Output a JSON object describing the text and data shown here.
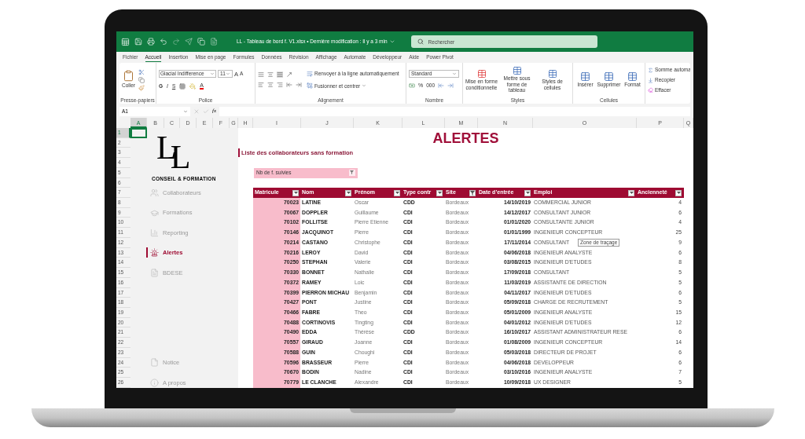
{
  "window": {
    "title": "LL - Tableau de bord f. V1.xlsx • Dernière modification : Il y a 3 min",
    "search": {
      "placeholder": "Rechercher"
    }
  },
  "menu": [
    {
      "label": "Fichier",
      "selected": false
    },
    {
      "label": "Accueil",
      "selected": true
    },
    {
      "label": "Insertion",
      "selected": false
    },
    {
      "label": "Mise en page",
      "selected": false
    },
    {
      "label": "Formules",
      "selected": false
    },
    {
      "label": "Données",
      "selected": false
    },
    {
      "label": "Révision",
      "selected": false
    },
    {
      "label": "Affichage",
      "selected": false
    },
    {
      "label": "Automate",
      "selected": false
    },
    {
      "label": "Développeur",
      "selected": false
    },
    {
      "label": "Aide",
      "selected": false
    },
    {
      "label": "Power Pivot",
      "selected": false
    }
  ],
  "ribbon": {
    "clipboard": {
      "paste": "Coller",
      "label": "Presse-papiers"
    },
    "font": {
      "name": "Glacial Indifference",
      "size": "11",
      "grow": "A",
      "shrink": "A",
      "bold": "G",
      "italic": "I",
      "underline": "S",
      "text_color_button": "A",
      "label": "Police"
    },
    "alignment": {
      "wrap": "Renvoyer à la ligne automatiquement",
      "merge": "Fusionner et centrer",
      "label": "Alignement"
    },
    "number": {
      "format": "Standard",
      "percent": "%",
      "thousands": "000",
      "label": "Nombre"
    },
    "styles": {
      "buttons": [
        "Mise en forme conditionnelle",
        "Mettre sous forme de tableau",
        "Styles de cellules"
      ],
      "label": "Styles"
    },
    "cells": {
      "buttons": [
        "Insérer",
        "Supprimer",
        "Format"
      ],
      "label": "Cellules"
    },
    "editing": {
      "buttons": [
        "Somme automa",
        "Recopier",
        "Effacer"
      ]
    }
  },
  "formula_bar": {
    "name_box": "A1",
    "fx": "fx"
  },
  "sheet": {
    "columns": [
      {
        "label": "A",
        "selected": true
      },
      {
        "label": "B",
        "selected": false
      },
      {
        "label": "C",
        "selected": false
      },
      {
        "label": "D",
        "selected": false
      },
      {
        "label": "E",
        "selected": false
      },
      {
        "label": "F",
        "selected": false
      },
      {
        "label": "G",
        "selected": false
      },
      {
        "label": "H",
        "selected": false
      },
      {
        "label": "I",
        "selected": false
      },
      {
        "label": "J",
        "selected": false
      },
      {
        "label": "K",
        "selected": false
      },
      {
        "label": "L",
        "selected": false
      },
      {
        "label": "M",
        "selected": false
      },
      {
        "label": "N",
        "selected": false
      },
      {
        "label": "O",
        "selected": false
      },
      {
        "label": "P",
        "selected": false
      },
      {
        "label": "Q",
        "selected": false
      }
    ],
    "rows": [
      {
        "label": "1",
        "selected": true
      },
      {
        "label": "2",
        "selected": false
      },
      {
        "label": "3",
        "selected": false
      },
      {
        "label": "4",
        "selected": false
      },
      {
        "label": "5",
        "selected": false
      },
      {
        "label": "6",
        "selected": false
      },
      {
        "label": "7",
        "selected": false
      },
      {
        "label": "8",
        "selected": false
      },
      {
        "label": "9",
        "selected": false
      },
      {
        "label": "10",
        "selected": false
      },
      {
        "label": "11",
        "selected": false
      },
      {
        "label": "12",
        "selected": false
      },
      {
        "label": "13",
        "selected": false
      },
      {
        "label": "14",
        "selected": false
      },
      {
        "label": "15",
        "selected": false
      },
      {
        "label": "16",
        "selected": false
      },
      {
        "label": "17",
        "selected": false
      },
      {
        "label": "18",
        "selected": false
      },
      {
        "label": "19",
        "selected": false
      },
      {
        "label": "20",
        "selected": false
      },
      {
        "label": "21",
        "selected": false
      },
      {
        "label": "22",
        "selected": false
      },
      {
        "label": "23",
        "selected": false
      },
      {
        "label": "24",
        "selected": false
      },
      {
        "label": "25",
        "selected": false
      },
      {
        "label": "26",
        "selected": false
      }
    ]
  },
  "sidebar": {
    "logo": {
      "letters": [
        "L",
        "L"
      ],
      "tagline": "CONSEIL & FORMATION"
    },
    "nav": [
      {
        "label": "Collaborateurs",
        "selected": false
      },
      {
        "label": "Formations",
        "selected": false
      },
      {
        "label": "Reporting",
        "selected": false
      },
      {
        "label": "Alertes",
        "selected": true
      },
      {
        "label": "BDESE",
        "selected": false
      },
      {
        "label": "Notice",
        "selected": false
      },
      {
        "label": "A propos",
        "selected": false
      }
    ]
  },
  "main": {
    "title": "ALERTES",
    "subtitle": "Liste des collaborateurs sans formation",
    "slicer": {
      "label": "Nb de f. suivies"
    },
    "tooltip": "Zone de traçage",
    "table": {
      "columns": [
        {
          "label": "Matricule",
          "filtered": false
        },
        {
          "label": "Nom",
          "filtered": false
        },
        {
          "label": "Prénom",
          "filtered": false
        },
        {
          "label": "Type contr",
          "filtered": false
        },
        {
          "label": "Site",
          "filtered": true
        },
        {
          "label": "Date d’entrée",
          "filtered": false
        },
        {
          "label": "Emploi",
          "filtered": false
        },
        {
          "label": "Ancienneté",
          "filtered": false
        }
      ],
      "rows": [
        [
          "70023",
          "LATINE",
          "Oscar",
          "CDD",
          "Bordeaux",
          "14/10/2019",
          "COMMERCIAL JUNIOR",
          "4"
        ],
        [
          "70067",
          "DOPPLER",
          "Guillaume",
          "CDI",
          "Bordeaux",
          "14/12/2017",
          "CONSULTANT JUNIOR",
          "6"
        ],
        [
          "70102",
          "FOLLITSE",
          "Pierre Etienne",
          "CDI",
          "Bordeaux",
          "01/01/2020",
          "CONSULTANTE JUNIOR",
          "4"
        ],
        [
          "70146",
          "JACQUINOT",
          "Pierre",
          "CDI",
          "Bordeaux",
          "01/01/1999",
          "INGENIEUR CONCEPTEUR",
          "25"
        ],
        [
          "70214",
          "CASTANO",
          "Christophe",
          "CDI",
          "Bordeaux",
          "17/11/2014",
          "CONSULTANT",
          "9"
        ],
        [
          "70216",
          "LEROY",
          "David",
          "CDI",
          "Bordeaux",
          "04/06/2018",
          "INGENIEUR ANALYSTE",
          "6"
        ],
        [
          "70250",
          "STEPHAN",
          "Valerie",
          "CDI",
          "Bordeaux",
          "03/08/2015",
          "INGENIEUR D'ETUDES",
          "8"
        ],
        [
          "70330",
          "BONNET",
          "Nathalie",
          "CDI",
          "Bordeaux",
          "17/09/2018",
          "CONSULTANT",
          "5"
        ],
        [
          "70372",
          "RAMEY",
          "Loic",
          "CDI",
          "Bordeaux",
          "11/03/2019",
          "ASSISTANTE DE DIRECTION",
          "5"
        ],
        [
          "70399",
          "PIERRON MICHAU",
          "Benjamin",
          "CDI",
          "Bordeaux",
          "04/11/2017",
          "INGENIEUR D'ETUDES",
          "6"
        ],
        [
          "70427",
          "PONT",
          "Justine",
          "CDI",
          "Bordeaux",
          "05/09/2018",
          "CHARGE DE RECRUTEMENT",
          "5"
        ],
        [
          "70466",
          "FABRE",
          "Theo",
          "CDI",
          "Bordeaux",
          "05/01/2009",
          "INGENIEUR ANALYSTE",
          "15"
        ],
        [
          "70488",
          "CORTINOVIS",
          "Tingting",
          "CDI",
          "Bordeaux",
          "04/01/2012",
          "INGENIEUR D'ETUDES",
          "12"
        ],
        [
          "70490",
          "EDDA",
          "Thérèse",
          "CDD",
          "Bordeaux",
          "16/10/2017",
          "ASSISTANT ADMINISTRATEUR RESE",
          "6"
        ],
        [
          "70557",
          "GIRAUD",
          "Joanne",
          "CDI",
          "Bordeaux",
          "01/08/2009",
          "INGENIEUR CONCEPTEUR",
          "14"
        ],
        [
          "70588",
          "GUIN",
          "Choughi",
          "CDI",
          "Bordeaux",
          "05/03/2018",
          "DIRECTEUR DE PROJET",
          "6"
        ],
        [
          "70596",
          "BRASSEUR",
          "Pierre",
          "CDI",
          "Bordeaux",
          "04/06/2018",
          "DEVELOPPEUR",
          "6"
        ],
        [
          "70670",
          "BODIN",
          "Nadine",
          "CDI",
          "Bordeaux",
          "03/10/2016",
          "INGENIEUR ANALYSTE",
          "7"
        ],
        [
          "70779",
          "LE CLANCHE",
          "Alexandre",
          "CDI",
          "Bordeaux",
          "10/09/2018",
          "UX DESIGNER",
          "5"
        ]
      ]
    }
  }
}
